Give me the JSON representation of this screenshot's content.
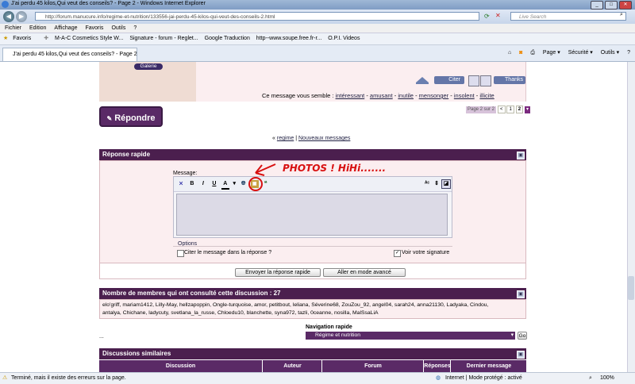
{
  "window": {
    "title": "J'ai perdu 45 kilos,Qui veut des conseils? - Page 2 - Windows Internet Explorer"
  },
  "address": {
    "url": "http://forum.manucure.info/regime-et-nutrition/133556-jai-perdu-45-kilos-qui-veut-des-conseils-2.html",
    "search_placeholder": "Live Search"
  },
  "menu": [
    "Fichier",
    "Edition",
    "Affichage",
    "Favoris",
    "Outils",
    "?"
  ],
  "favorites": {
    "label": "Favoris",
    "items": [
      "M-A-C Cosmetics  Style W...",
      "Signature - forum - Reglet...",
      "Google Traduction",
      "http--www.soupe.free.fr-r...",
      "O.P.I. Videos"
    ]
  },
  "tab": {
    "label": "J'ai perdu 45 kilos,Qui veut des conseils? - Page 2"
  },
  "tools": [
    "Page ▾",
    "Sécurité ▾",
    "Outils ▾"
  ],
  "post": {
    "gallery_label": "Galerie",
    "citer_label": "Citer",
    "thanks_label": "Thanks",
    "vote_label": "Ce message vous semble :",
    "vote_options": [
      "intéressant",
      "amusant",
      "inutile",
      "mensonger",
      "insolent",
      "illicite"
    ]
  },
  "pagination": {
    "label": "Page 2 sur 2",
    "pages": [
      "<",
      "1",
      "2"
    ]
  },
  "reply_button": "Répondre",
  "breadcrumb": {
    "prefix": "«",
    "links": [
      "regime",
      "Nouveaux messages"
    ],
    "sep": "|"
  },
  "quick_reply": {
    "header": "Réponse rapide",
    "message_label": "Message:",
    "annotation": "PHOTOS ! HiHi.......",
    "options_label": "Options",
    "quote_checkbox": "Citer le message dans la réponse ?",
    "signature_checkbox": "Voir votre signature",
    "submit": "Envoyer la réponse rapide",
    "advanced": "Aller en mode avancé"
  },
  "members": {
    "header": "Nombre de membres qui ont consulté cette discussion : 27",
    "line1": "elo'griff, mariam1412, Lilly-May, hellzapoppin, Ongle-turquoise, amor, petitbout, leliana, Séverine68, ZouZou_92, angel04, sarah24, anna21130, Ladyaka, Cindou,",
    "line2": "antalya, Chichane, ladycuty, svetlana_la_russe, Chloedu10, blanchette, syna972, tazli, 0ceanne, nosilla, MalSsaLiA"
  },
  "quicknav": {
    "label": "Navigation rapide",
    "selected": "Régime et nutrition",
    "go": "Go"
  },
  "ellipsis": "...",
  "similar": {
    "header": "Discussions similaires",
    "columns": [
      "Discussion",
      "Auteur",
      "Forum",
      "Réponses",
      "Dernier message"
    ]
  },
  "status": {
    "left": "Terminé, mais il existe des erreurs sur la page.",
    "zone": "Internet | Mode protégé : activé",
    "zoom": "100%"
  },
  "colors": {
    "header": "#4b1f4e",
    "accent": "#7b2a7f",
    "pink": "#fbeef0"
  }
}
